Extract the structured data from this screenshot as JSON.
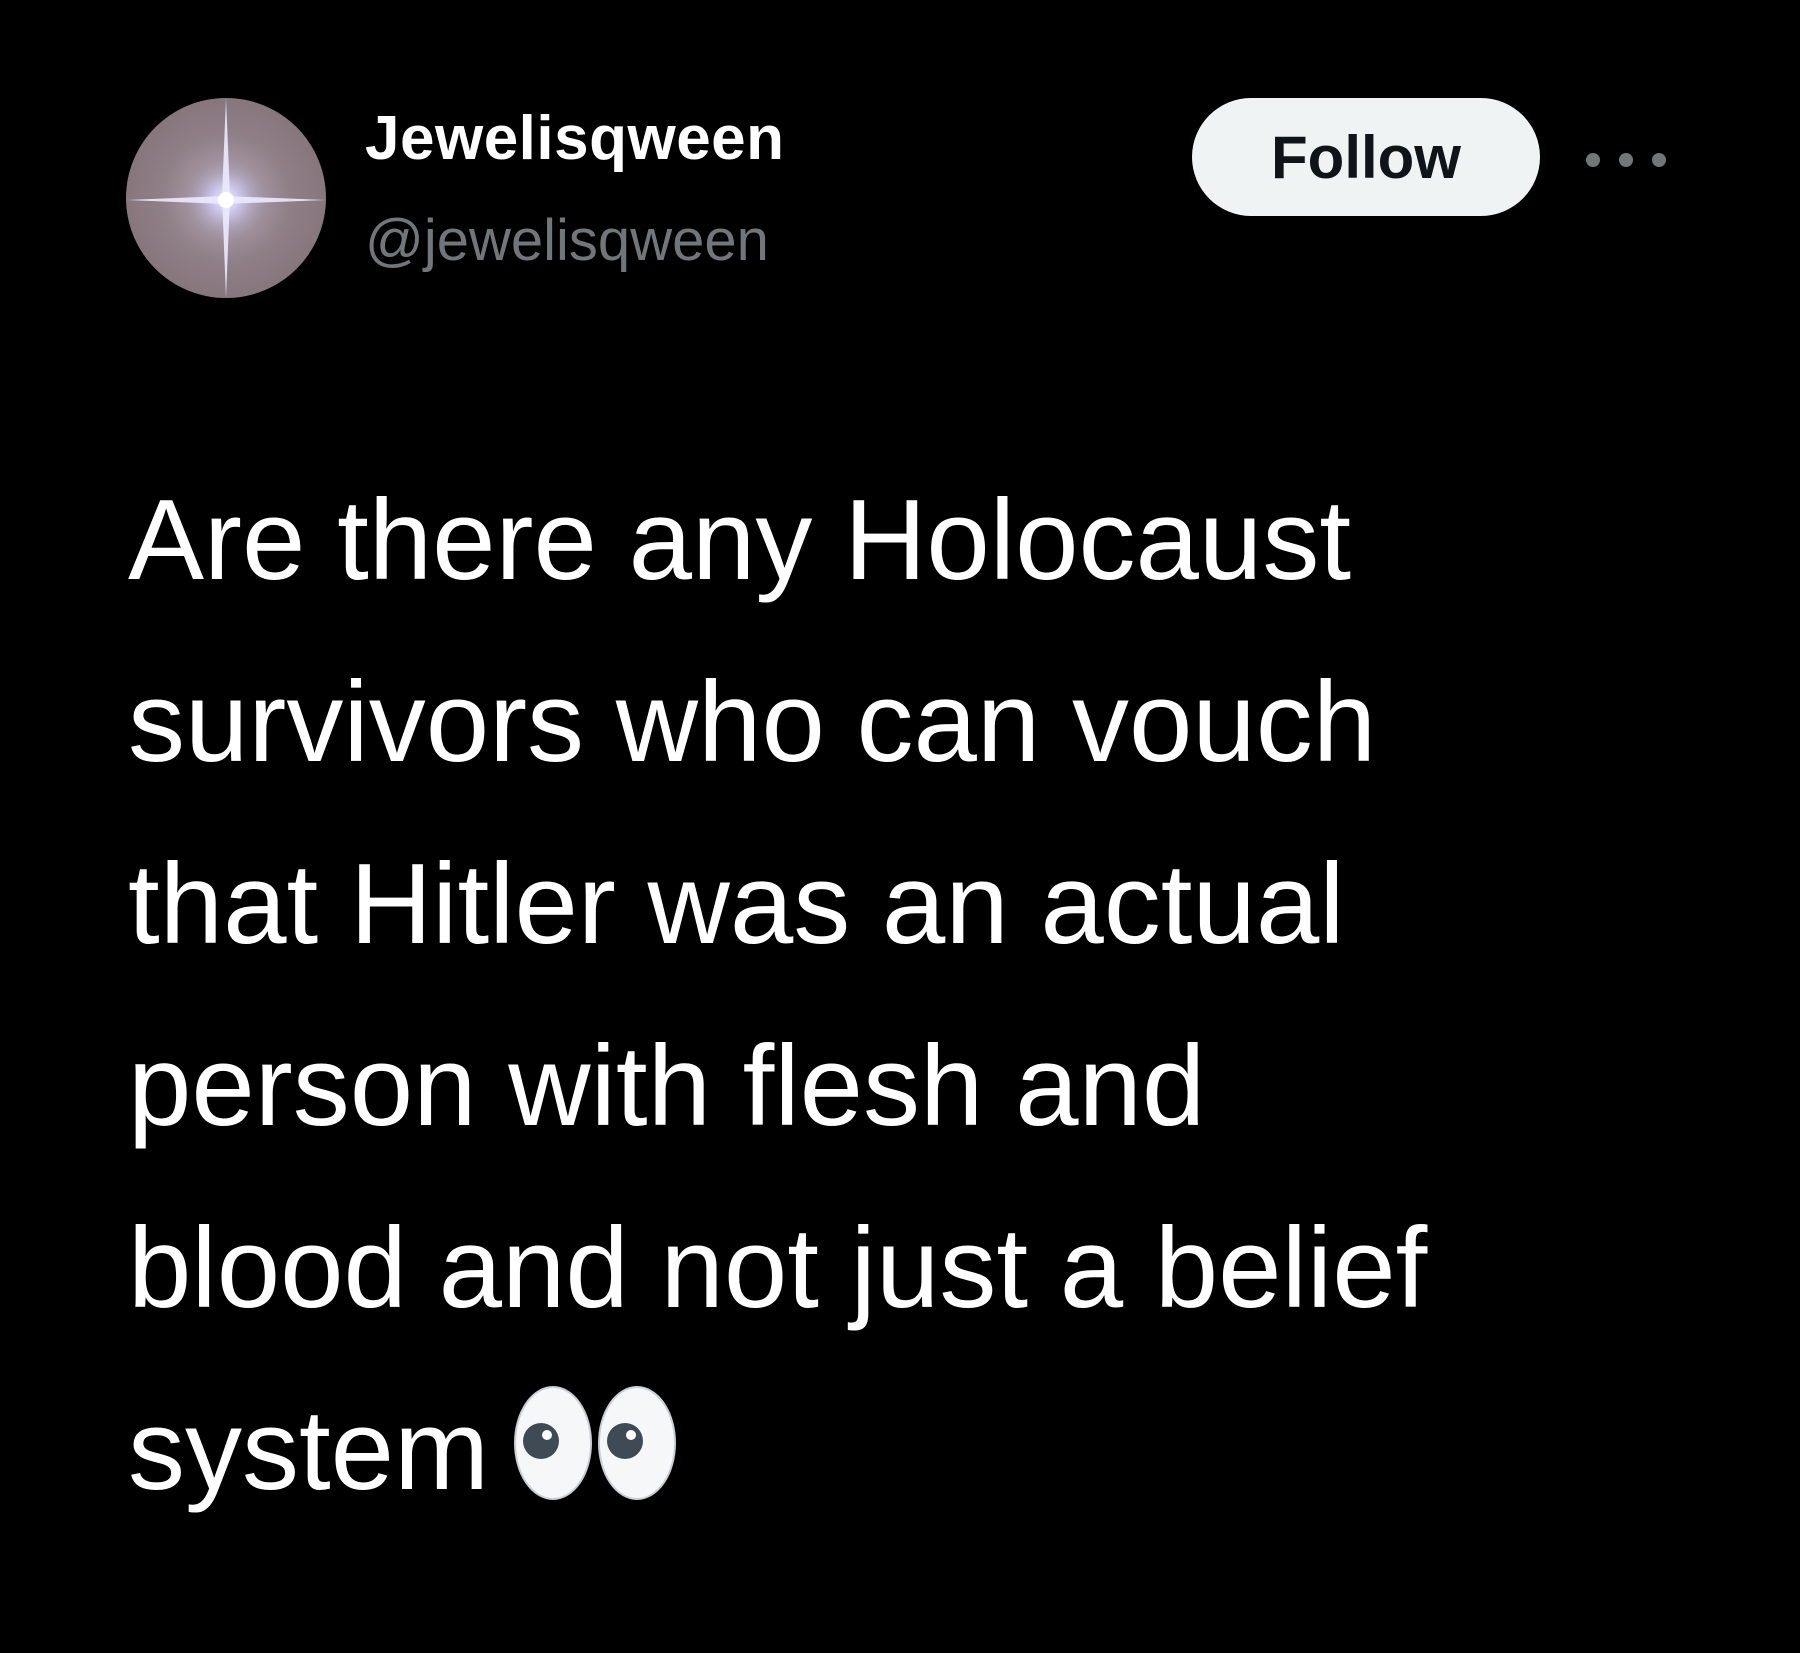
{
  "tweet": {
    "author": {
      "display_name": "Jewelisqween",
      "handle": "@jewelisqween"
    },
    "follow_label": "Follow",
    "more_icon": "more-horizontal-icon",
    "text_lines": [
      "Are there any Holocaust",
      "survivors who can vouch",
      "that Hitler was an actual",
      "person with flesh and",
      "blood and not just a belief",
      "system"
    ],
    "emoji": "eyes-emoji"
  },
  "colors": {
    "background": "#000000",
    "text": "#ffffff",
    "secondary_text": "#71767b",
    "follow_bg": "#eff3f4",
    "follow_text": "#0f1419"
  }
}
